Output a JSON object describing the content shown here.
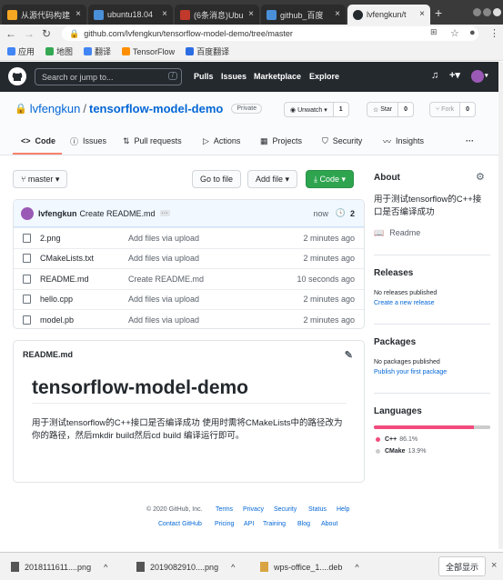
{
  "browser": {
    "tabs": [
      {
        "label": "从源代码构建",
        "color": "#f5a623"
      },
      {
        "label": "ubuntu18.04",
        "color": "#4a90d9"
      },
      {
        "label": "(6条消息)Ubu",
        "color": "#c0392b"
      },
      {
        "label": "github_百度",
        "color": "#4a90d9"
      },
      {
        "label": "lvfengkun/t",
        "color": "#24292e"
      }
    ],
    "new_tab": "+",
    "close": "×",
    "url": "github.com/lvfengkun/tensorflow-model-demo/tree/master",
    "bookmarks": [
      {
        "label": "应用",
        "color": "#4285f4"
      },
      {
        "label": "地图",
        "color": "#34a853"
      },
      {
        "label": "翻译",
        "color": "#4285f4"
      },
      {
        "label": "TensorFlow",
        "color": "#ff8f00"
      },
      {
        "label": "百度翻译",
        "color": "#2b6de3"
      }
    ]
  },
  "github": {
    "search_placeholder": "Search or jump to...",
    "slash": "/",
    "nav": [
      "Pulls",
      "Issues",
      "Marketplace",
      "Explore"
    ]
  },
  "repo": {
    "owner": "lvfengkun",
    "sep": "/",
    "name": "tensorflow-model-demo",
    "visibility": "Private",
    "unwatch": {
      "label": "Unwatch ▾",
      "count": "1"
    },
    "star": {
      "label": "Star",
      "count": "0"
    },
    "fork": {
      "label": "Fork",
      "count": "0"
    },
    "tabs": [
      "Code",
      "Issues",
      "Pull requests",
      "Actions",
      "Projects",
      "Security",
      "Insights"
    ],
    "more": "···"
  },
  "files": {
    "branch": "master ▾",
    "goto": "Go to file",
    "add": "Add file ▾",
    "code": "Code ▾",
    "commit_user": "lvfengkun",
    "commit_msg": "Create README.md",
    "commit_more": "···",
    "commit_time": "now",
    "commit_count": "2",
    "rows": [
      {
        "name": "2.png",
        "msg": "Add files via upload",
        "time": "2 minutes ago"
      },
      {
        "name": "CMakeLists.txt",
        "msg": "Add files via upload",
        "time": "2 minutes ago"
      },
      {
        "name": "README.md",
        "msg": "Create README.md",
        "time": "10 seconds ago"
      },
      {
        "name": "hello.cpp",
        "msg": "Add files via upload",
        "time": "2 minutes ago"
      },
      {
        "name": "model.pb",
        "msg": "Add files via upload",
        "time": "2 minutes ago"
      }
    ]
  },
  "readme": {
    "file": "README.md",
    "title": "tensorflow-model-demo",
    "body": "用于测试tensorflow的C++接口是否编译成功 使用时需将CMakeLists中的路径改为你的路径，然后mkdir build然后cd build 编译运行即可。"
  },
  "sidebar": {
    "about": "About",
    "desc": "用于测试tensorflow的C++接口是否编译成功",
    "readme": "Readme",
    "releases": "Releases",
    "no_releases": "No releases published",
    "create_release": "Create a new release",
    "packages": "Packages",
    "no_packages": "No packages published",
    "publish_package": "Publish your first package",
    "languages": "Languages",
    "langs": [
      {
        "name": "C++",
        "pct": "86.1%",
        "value": 86.1,
        "color": "#f34b7d"
      },
      {
        "name": "CMake",
        "pct": "13.9%",
        "value": 13.9,
        "color": "#cccccc"
      }
    ]
  },
  "footer": {
    "copyright": "© 2020 GitHub, Inc.",
    "row1": [
      "Terms",
      "Privacy",
      "Security",
      "Status",
      "Help"
    ],
    "row2": [
      "Contact GitHub",
      "Pricing",
      "API",
      "Training",
      "Blog",
      "About"
    ]
  },
  "downloads": {
    "items": [
      "2018111611....png",
      "2019082910....png",
      "wps-office_1....deb"
    ],
    "caret": "^",
    "show_all": "全部显示",
    "close": "×"
  }
}
